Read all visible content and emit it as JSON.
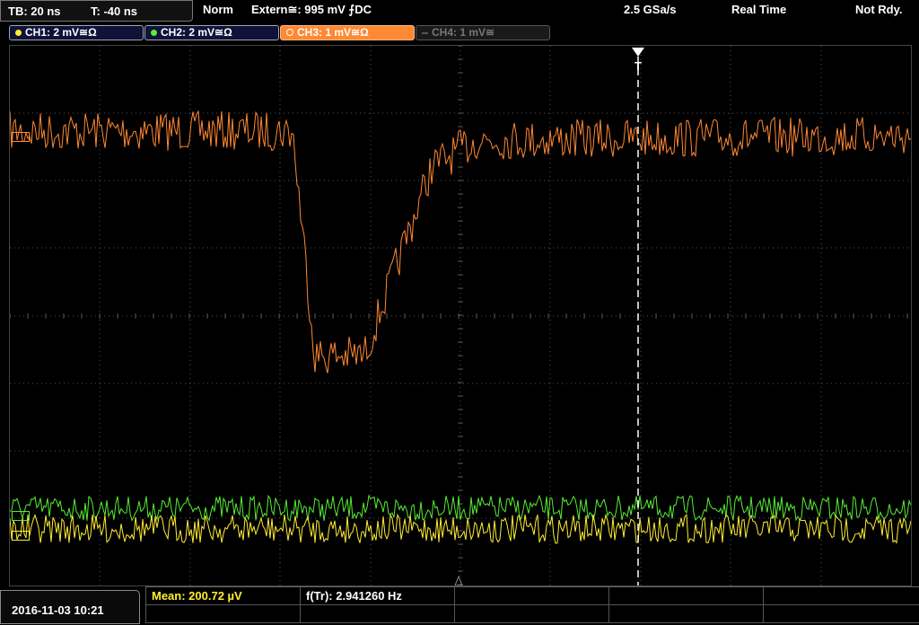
{
  "header": {
    "timebase": "TB: 20 ns",
    "trigger_time": "T: -40 ns",
    "mode": "Norm",
    "trigger_source": "Extern≅: 995 mV ⨍DC",
    "sample_rate": "2.5 GSa/s",
    "acq_mode": "Real Time",
    "status": "Not Rdy."
  },
  "channels": [
    {
      "label": "CH1: 2 mV≅Ω",
      "color": "#ffee33",
      "active": true
    },
    {
      "label": "CH2: 2 mV≅Ω",
      "color": "#55ee33",
      "active": true
    },
    {
      "label": "CH3: 1 mV≅Ω",
      "color": "#ff8833",
      "active": true,
      "selected": true
    },
    {
      "label": "CH4: 1 mV≅",
      "color": "#888888",
      "active": false
    }
  ],
  "trigger_marker": "T",
  "footer": {
    "datetime": "2016-11-03 10:21",
    "measurements": [
      {
        "label": "Mean: 200.72 µV",
        "color": "#ffee33"
      },
      {
        "label": "f(Tr): 2.941260 Hz",
        "color": "#ffffff"
      }
    ]
  },
  "colors": {
    "ch1": "#ffee33",
    "ch2": "#55ee33",
    "ch3": "#ff8833",
    "grid": "#555555",
    "background": "#000000"
  }
}
